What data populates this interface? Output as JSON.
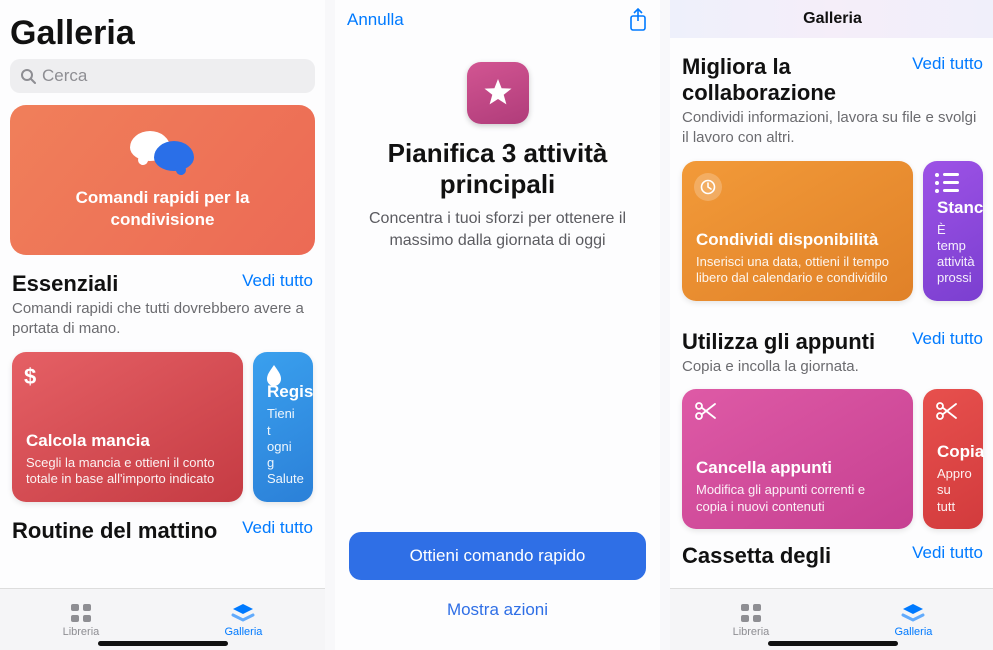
{
  "screen1": {
    "page_title": "Galleria",
    "search_placeholder": "Cerca",
    "hero": {
      "title": "Comandi rapidi per la condivisione"
    },
    "section_essenziali": {
      "title": "Essenziali",
      "see_all": "Vedi tutto",
      "subtitle": "Comandi rapidi che tutti dovrebbero avere a portata di mano."
    },
    "card_mancia": {
      "title": "Calcola mancia",
      "desc": "Scegli la mancia e ottieni il conto totale in base all'importo indicato"
    },
    "card_registra": {
      "title_partial": "Regis",
      "desc_partial_l1": "Tieni t",
      "desc_partial_l2": "ogni g",
      "desc_partial_l3": "Salute"
    },
    "section_routine": {
      "title": "Routine del mattino",
      "see_all": "Vedi tutto"
    },
    "tab_libreria": "Libreria",
    "tab_galleria": "Galleria"
  },
  "screen2": {
    "cancel": "Annulla",
    "title": "Pianifica 3 attività principali",
    "subtitle": "Concentra i tuoi sforzi per ottenere il massimo dalla giornata di oggi",
    "primary_button": "Ottieni comando rapido",
    "secondary_link": "Mostra azioni"
  },
  "screen3": {
    "header": "Galleria",
    "section_collab": {
      "title_l1": "Migliora la",
      "title_l2": "collaborazione",
      "see_all": "Vedi tutto",
      "subtitle": "Condividi informazioni, lavora su file e svolgi il lavoro con altri."
    },
    "card_dispon": {
      "title": "Condividi disponibilità",
      "desc": "Inserisci una data, ottieni il tempo libero dal calendario e condividilo"
    },
    "card_standup": {
      "title_partial": "Stanc",
      "desc_partial_l1": "È temp",
      "desc_partial_l2": "attività",
      "desc_partial_l3": "prossi"
    },
    "section_appunti": {
      "title": "Utilizza gli appunti",
      "see_all": "Vedi tutto",
      "subtitle": "Copia e incolla la giornata."
    },
    "card_cancella": {
      "title": "Cancella appunti",
      "desc": "Modifica gli appunti correnti e copia i nuovi contenuti"
    },
    "card_copia": {
      "title_partial": "Copia",
      "desc_partial_l1": "Appro",
      "desc_partial_l2": "su tutt"
    },
    "section_cassetta": {
      "title": "Cassetta degli",
      "see_all": "Vedi tutto"
    },
    "tab_libreria": "Libreria",
    "tab_galleria": "Galleria"
  }
}
